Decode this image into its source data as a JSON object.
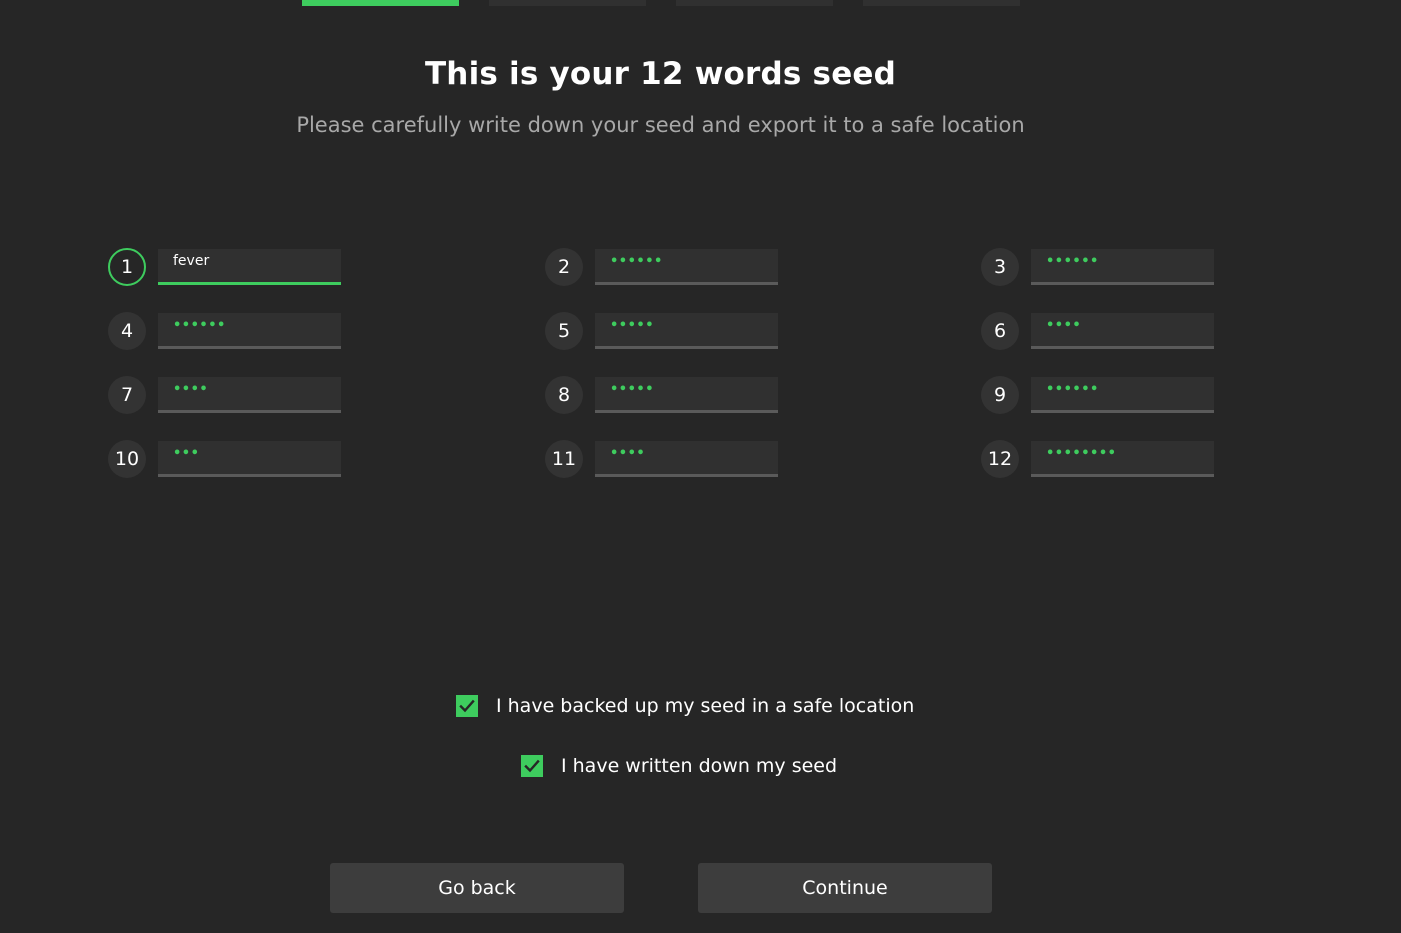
{
  "progress": {
    "steps_total": 4,
    "current_step": 1
  },
  "header": {
    "title": "This is your 12 words seed",
    "subtitle": "Please carefully write down your seed and export it to a safe location"
  },
  "seed_words": [
    {
      "index": "1",
      "value": "fever",
      "revealed": true
    },
    {
      "index": "2",
      "value": "••••••",
      "revealed": false
    },
    {
      "index": "3",
      "value": "••••••",
      "revealed": false
    },
    {
      "index": "4",
      "value": "••••••",
      "revealed": false
    },
    {
      "index": "5",
      "value": "•••••",
      "revealed": false
    },
    {
      "index": "6",
      "value": "••••",
      "revealed": false
    },
    {
      "index": "7",
      "value": "••••",
      "revealed": false
    },
    {
      "index": "8",
      "value": "•••••",
      "revealed": false
    },
    {
      "index": "9",
      "value": "••••••",
      "revealed": false
    },
    {
      "index": "10",
      "value": "•••",
      "revealed": false
    },
    {
      "index": "11",
      "value": "••••",
      "revealed": false
    },
    {
      "index": "12",
      "value": "••••••••",
      "revealed": false
    }
  ],
  "confirmations": {
    "backed_up": {
      "label": "I have backed up my seed in a safe location",
      "checked": true
    },
    "written_down": {
      "label": "I have written down my seed",
      "checked": true
    }
  },
  "actions": {
    "go_back_label": "Go back",
    "continue_label": "Continue"
  },
  "colors": {
    "accent": "#3ecc5e",
    "background": "#262626",
    "field": "#303030",
    "button": "#3d3d3d"
  }
}
